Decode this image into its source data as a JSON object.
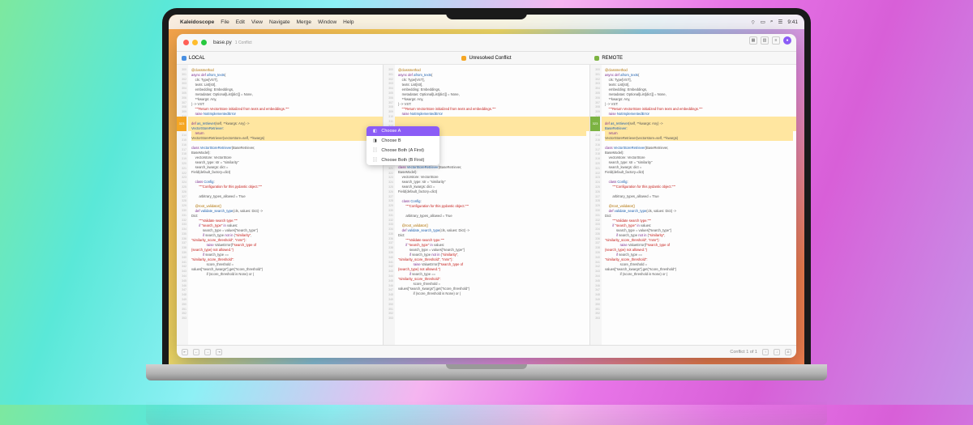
{
  "menubar": {
    "app": "Kaleidoscope",
    "items": [
      "File",
      "Edit",
      "View",
      "Navigate",
      "Merge",
      "Window",
      "Help"
    ],
    "clock": "9:41"
  },
  "window": {
    "title": "base.py",
    "subtitle": "1 Conflict"
  },
  "columns": {
    "left": "LOCAL",
    "center": "Unresolved Conflict",
    "right": "REMOTE"
  },
  "conflict_menu": {
    "choose_a": "Choose A",
    "choose_b": "Choose B",
    "both_a": "Choose Both (A First)",
    "both_b": "Choose Both (B First)"
  },
  "diff_marker": "323",
  "code": {
    "line_start": 300,
    "l1": "@classmethod",
    "l2": "async def afrom_texts(",
    "l3": "cls: Type[VST],",
    "l4": "texts: List[str],",
    "l5": "embedding: Embeddings,",
    "l6": "metadatas: Optional[List[dict]] = None,",
    "l7": "**kwargs: Any,",
    "l8": ") -> VST:",
    "l9": "\"\"\"Return VectorStore initialized from texts and embeddings.\"\"\"",
    "l10": "raise NotImplementedError",
    "l11": "def as_retriever(self, **kwargs: Any) ->",
    "l11b": "VectorStoreRetriever:",
    "l12": "return",
    "l13": "VectorStoreRetriever(vectorstore=self, **kwargs)",
    "l11r": "def as_retriever(self, **kwargs: Any) ->",
    "l11rb": "BaseRetriever:",
    "l14": "class VectorStoreRetriever(BaseRetriever,",
    "l14b": "BaseModel):",
    "l15": "vectorstore: VectorStore",
    "l16": "search_type: str = \"similarity\"",
    "l17": "search_kwargs: dict =",
    "l17b": "Field(default_factory=dict)",
    "l18": "class Config:",
    "l19": "\"\"\"Configuration for this pydantic object.\"\"\"",
    "l20": "arbitrary_types_allowed = True",
    "l21": "@root_validator()",
    "l22": "def validate_search_type(cls, values: Dict) ->",
    "l22b": "Dict:",
    "l23": "\"\"\"Validate search type.\"\"\"",
    "l24": "if \"search_type\" in values:",
    "l25": "search_type = values[\"search_type\"]",
    "l26": "if search_type not in (\"similarity\",",
    "l26b": "\"similarity_score_threshold\", \"mmr\"):",
    "l27": "raise ValueError(f\"search_type of",
    "l27b": "{search_type} not allowed.\")",
    "l28": "if search_type ==",
    "l28b": "\"similarity_score_threshold\":",
    "l29": "score_threshold =",
    "l29b": "values[\"search_kwargs\"].get(\"score_threshold\")",
    "l30": "if (score_threshold is None) or ("
  },
  "status": {
    "conflict": "Conflict 1 of 1"
  }
}
